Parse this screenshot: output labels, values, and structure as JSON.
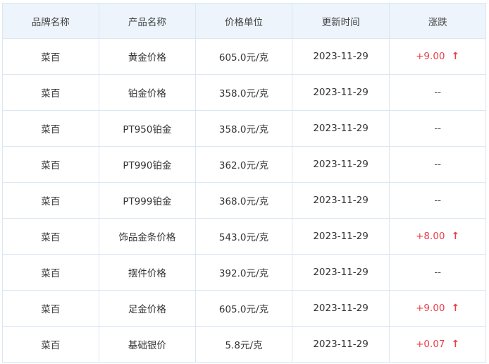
{
  "table": {
    "headers": [
      "品牌名称",
      "产品名称",
      "价格单位",
      "更新时间",
      "涨跌"
    ],
    "rows": [
      {
        "brand": "菜百",
        "product": "黄金价格",
        "price": "605.0元/克",
        "date": "2023-11-29",
        "change": "+9.00",
        "trend": "up"
      },
      {
        "brand": "菜百",
        "product": "铂金价格",
        "price": "358.0元/克",
        "date": "2023-11-29",
        "change": "--",
        "trend": "none"
      },
      {
        "brand": "菜百",
        "product": "PT950铂金",
        "price": "358.0元/克",
        "date": "2023-11-29",
        "change": "--",
        "trend": "none"
      },
      {
        "brand": "菜百",
        "product": "PT990铂金",
        "price": "362.0元/克",
        "date": "2023-11-29",
        "change": "--",
        "trend": "none"
      },
      {
        "brand": "菜百",
        "product": "PT999铂金",
        "price": "368.0元/克",
        "date": "2023-11-29",
        "change": "--",
        "trend": "none"
      },
      {
        "brand": "菜百",
        "product": "饰品金条价格",
        "price": "543.0元/克",
        "date": "2023-11-29",
        "change": "+8.00",
        "trend": "up"
      },
      {
        "brand": "菜百",
        "product": "摆件价格",
        "price": "392.0元/克",
        "date": "2023-11-29",
        "change": "--",
        "trend": "none"
      },
      {
        "brand": "菜百",
        "product": "足金价格",
        "price": "605.0元/克",
        "date": "2023-11-29",
        "change": "+9.00",
        "trend": "up"
      },
      {
        "brand": "菜百",
        "product": "基础银价",
        "price": "5.8元/克",
        "date": "2023-11-29",
        "change": "+0.07",
        "trend": "up"
      }
    ]
  },
  "icons": {
    "up_arrow": "↑"
  },
  "colors": {
    "header_bg": "#edf4fc",
    "border": "#dbe6f3",
    "up": "#e8404a"
  }
}
